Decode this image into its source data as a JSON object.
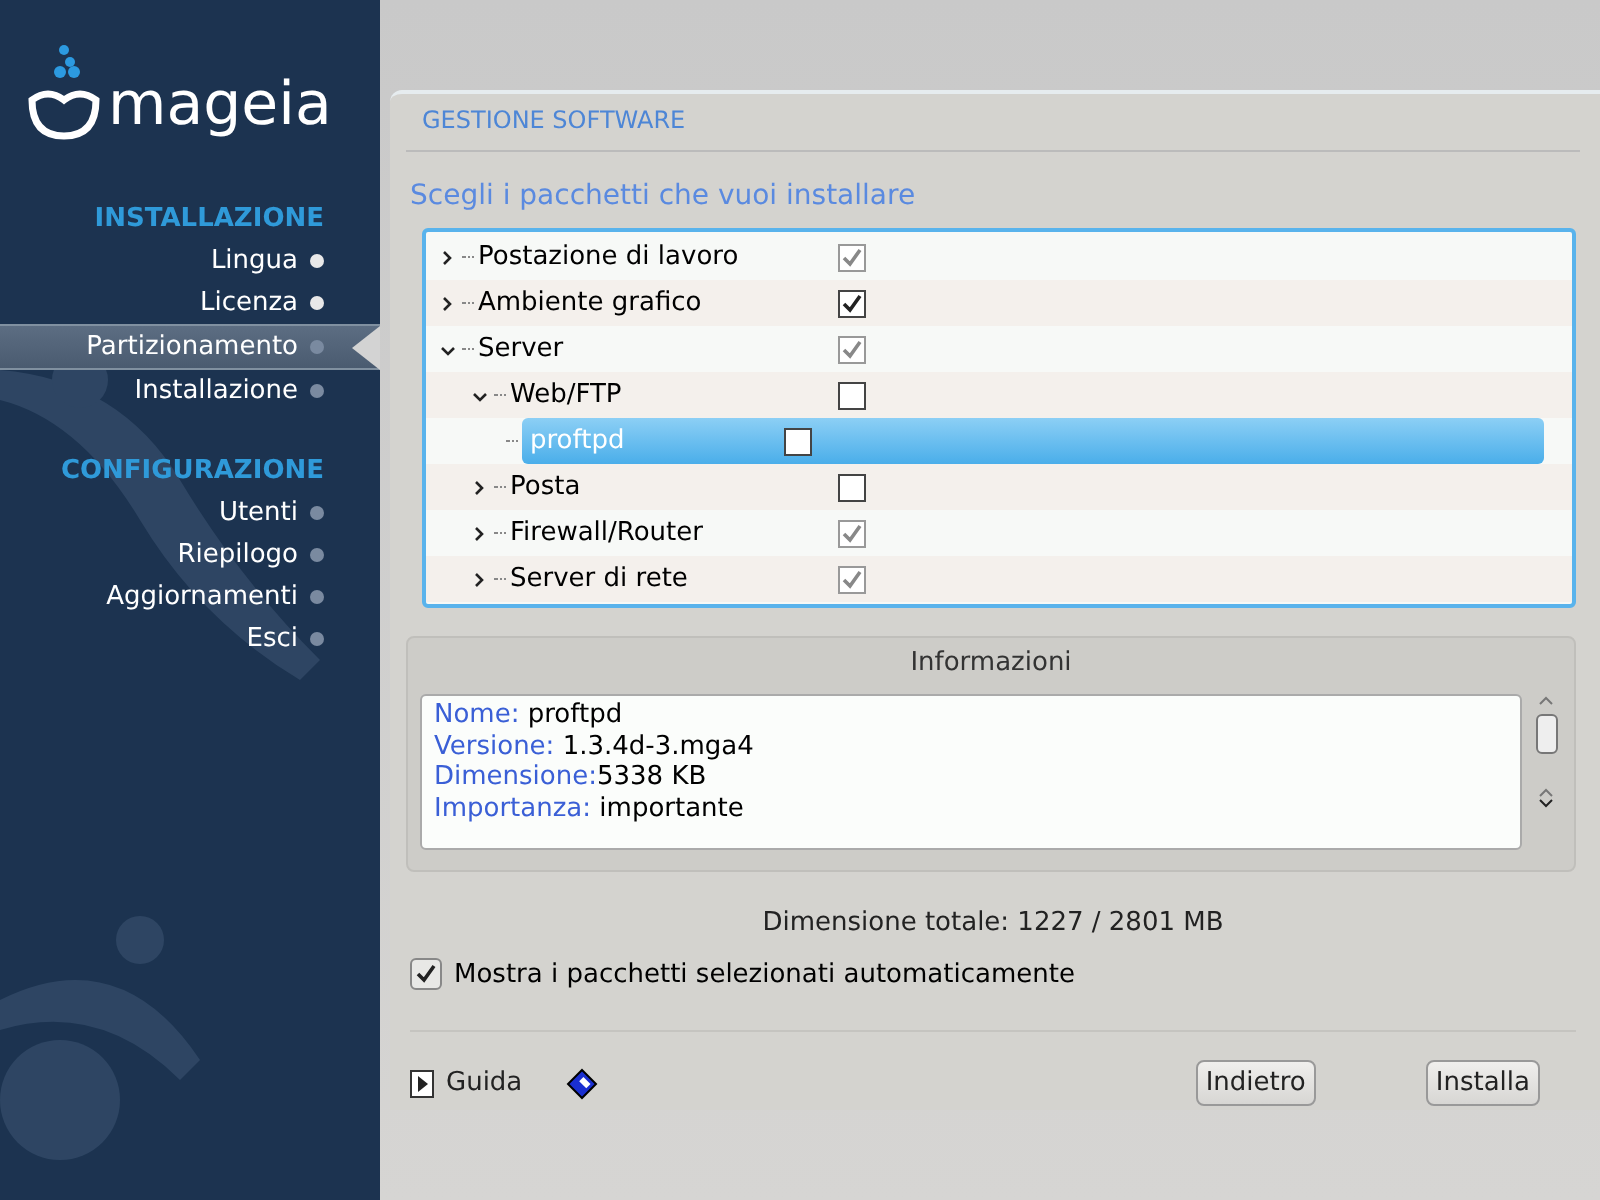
{
  "sidebar": {
    "logo": "mageia",
    "sections": [
      {
        "title": "INSTALLAZIONE",
        "items": [
          {
            "label": "Lingua",
            "done": true,
            "selected": false
          },
          {
            "label": "Licenza",
            "done": true,
            "selected": false
          },
          {
            "label": "Partizionamento",
            "done": false,
            "selected": true
          },
          {
            "label": "Installazione",
            "done": false,
            "selected": false
          }
        ]
      },
      {
        "title": "CONFIGURAZIONE",
        "items": [
          {
            "label": "Utenti",
            "done": false,
            "selected": false
          },
          {
            "label": "Riepilogo",
            "done": false,
            "selected": false
          },
          {
            "label": "Aggiornamenti",
            "done": false,
            "selected": false
          },
          {
            "label": "Esci",
            "done": false,
            "selected": false
          }
        ]
      }
    ]
  },
  "panel": {
    "title": "GESTIONE SOFTWARE",
    "subtitle": "Scegli i pacchetti che vuoi installare",
    "tree": [
      {
        "label": "Postazione di lavoro",
        "expanded": false,
        "checked": true,
        "dimmed": true,
        "selected": false
      },
      {
        "label": "Ambiente grafico",
        "expanded": false,
        "checked": true,
        "dimmed": false,
        "selected": false
      },
      {
        "label": "Server",
        "expanded": true,
        "checked": true,
        "dimmed": true,
        "selected": false,
        "children": [
          {
            "label": "Web/FTP",
            "expanded": true,
            "checked": false,
            "selected": false,
            "children": [
              {
                "label": "proftpd",
                "checked": false,
                "selected": true
              }
            ]
          },
          {
            "label": "Posta",
            "expanded": false,
            "checked": false,
            "selected": false
          },
          {
            "label": "Firewall/Router",
            "expanded": false,
            "checked": true,
            "dimmed": true,
            "selected": false
          },
          {
            "label": "Server di rete",
            "expanded": false,
            "checked": true,
            "dimmed": true,
            "selected": false
          }
        ]
      }
    ],
    "info": {
      "title": "Informazioni",
      "lines": [
        {
          "label": "Nome:",
          "value": " proftpd"
        },
        {
          "label": "Versione:",
          "value": " 1.3.4d-3.mga4"
        },
        {
          "label": "Dimensione:",
          "value": "5338 KB"
        },
        {
          "label": "Importanza:",
          "value": " importante"
        }
      ]
    },
    "total": "Dimensione totale: 1227 / 2801 MB",
    "auto_select": {
      "label": "Mostra i pacchetti selezionati automaticamente",
      "checked": true
    },
    "help": "Guida",
    "buttons": [
      "Indietro",
      "Installa"
    ]
  }
}
